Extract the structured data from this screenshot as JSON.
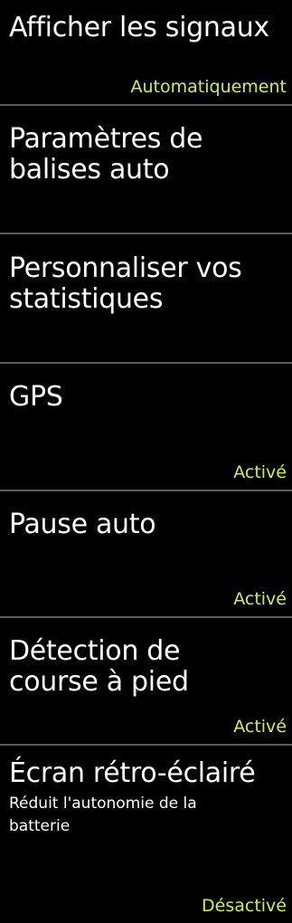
{
  "settings": [
    {
      "title": "Afficher les signaux",
      "status": "Automatiquement"
    },
    {
      "title": "Paramètres de\nbalises auto",
      "status": ""
    },
    {
      "title": "Personnaliser vos\nstatistiques",
      "status": ""
    },
    {
      "title": "GPS",
      "status": "Activé"
    },
    {
      "title": "Pause auto",
      "status": "Activé"
    },
    {
      "title": "Détection de\ncourse à pied",
      "status": "Activé"
    },
    {
      "title": "Écran rétro-éclairé",
      "subtitle": "Réduit l'autonomie de la\nbatterie",
      "status": "Désactivé"
    }
  ],
  "colors": {
    "background": "#000000",
    "text": "#ffffff",
    "status": "#d4ee3a",
    "divider": "#5a5a5a"
  }
}
